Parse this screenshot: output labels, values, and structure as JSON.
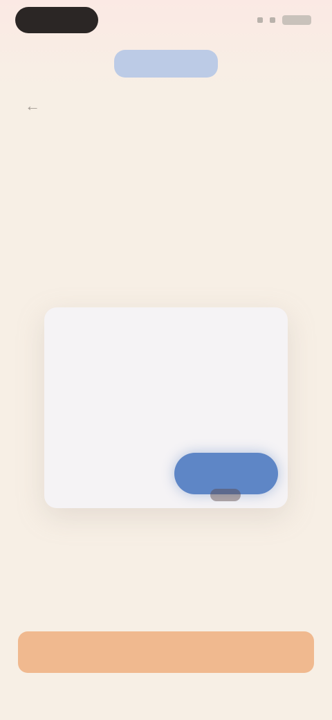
{
  "status_bar": {
    "icons": [
      "signal-icon",
      "wifi-icon",
      "battery-icon"
    ]
  },
  "header": {
    "logo_icon": "app-logo",
    "back_icon": "arrow-left-icon",
    "back_label": ""
  },
  "hero": {
    "title": "",
    "subtitle": ""
  },
  "dialog": {
    "title": "",
    "body": "",
    "secondary_label": "",
    "primary_label": ""
  },
  "footer": {
    "note": "",
    "cta_label": ""
  },
  "colors": {
    "background": "#f7efe5",
    "primary": "#5e86c6",
    "cta": "#f0b98f",
    "card": "#f5f3f5"
  }
}
